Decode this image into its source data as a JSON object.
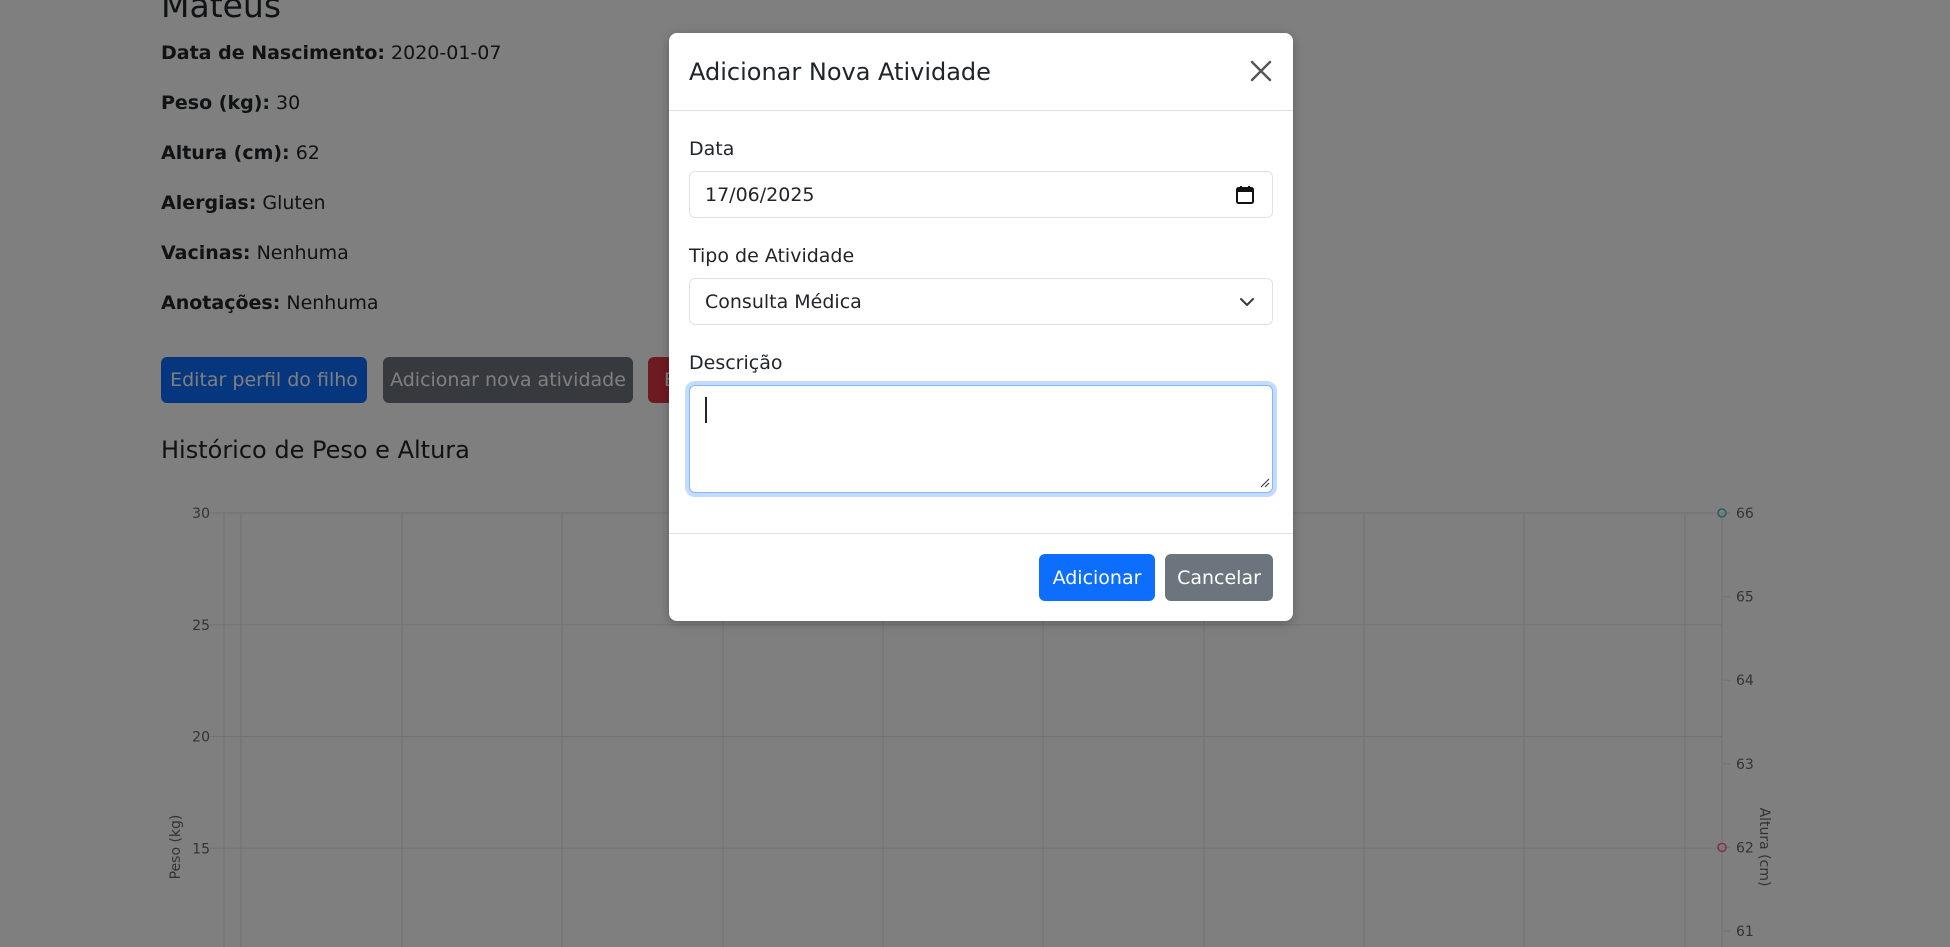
{
  "profile": {
    "name": "Mateus",
    "fields": [
      {
        "label": "Data de Nascimento:",
        "value": "2020-01-07"
      },
      {
        "label": "Peso (kg):",
        "value": "30"
      },
      {
        "label": "Altura (cm):",
        "value": "62"
      },
      {
        "label": "Alergias:",
        "value": "Gluten"
      },
      {
        "label": "Vacinas:",
        "value": "Nenhuma"
      },
      {
        "label": "Anotações:",
        "value": "Nenhuma"
      }
    ],
    "buttons": {
      "edit": "Editar perfil do filho",
      "add_activity": "Adicionar nova atividade",
      "danger": "E"
    },
    "history_title": "Histórico de Peso e Altura"
  },
  "chart_data": {
    "type": "line",
    "ylabel": "Peso (kg)",
    "y2label": "Altura (cm)",
    "y_ticks": [
      "30",
      "25",
      "20",
      "15"
    ],
    "y2_ticks": [
      "66",
      "65",
      "64",
      "63",
      "62",
      "61"
    ],
    "ylim_visible": [
      13,
      30
    ],
    "y2lim_visible": [
      61,
      66
    ],
    "series": [
      {
        "axis": "y2",
        "values": [
          66
        ],
        "color": "#4bc0c0"
      },
      {
        "axis": "y2",
        "values": [
          62
        ],
        "color": "#ff6384"
      }
    ],
    "grid": true
  },
  "modal": {
    "title": "Adicionar Nova Atividade",
    "date_label": "Data",
    "date_value": "17/06/2025",
    "type_label": "Tipo de Atividade",
    "type_value": "Consulta Médica",
    "description_label": "Descrição",
    "description_value": "",
    "submit_label": "Adicionar",
    "cancel_label": "Cancelar"
  },
  "icons": {
    "close": "close-icon",
    "calendar": "calendar-icon",
    "chevron": "chevron-down-icon"
  },
  "colors": {
    "primary": "#0d6efd",
    "secondary": "#6c757d",
    "danger": "#dc3545",
    "focus_ring": "#86b7fe"
  }
}
